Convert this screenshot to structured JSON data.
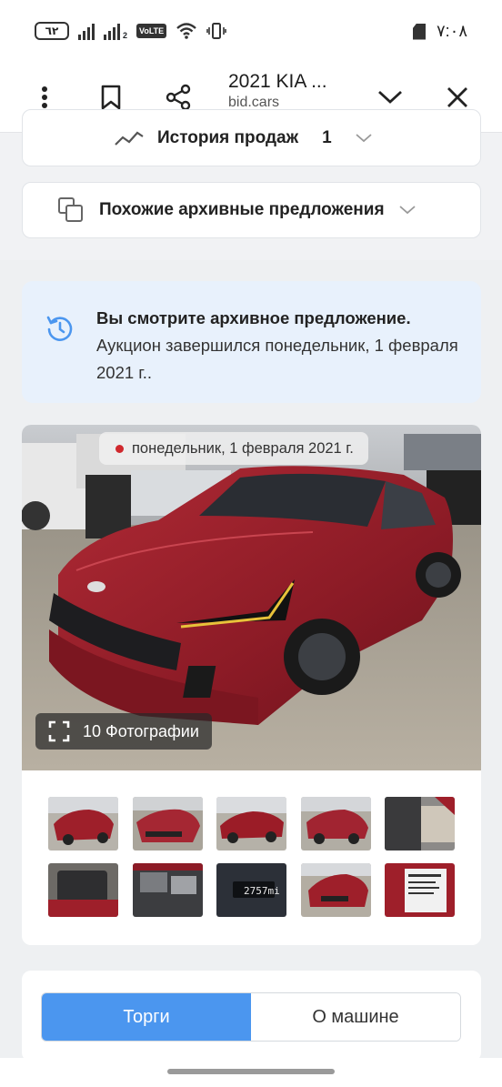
{
  "status_bar": {
    "battery": "٦٢",
    "sim2": "2",
    "volte": "VoLTE",
    "time": "٧:٠٨"
  },
  "header": {
    "title": "2021 KIA ...",
    "url": "bid.cars",
    "icons": [
      "more-vert-icon",
      "bookmark-icon",
      "share-icon",
      "chevron-down-icon",
      "close-icon"
    ]
  },
  "sales_history": {
    "label": "История продаж",
    "count": "1"
  },
  "similar": {
    "label": "Похожие архивные предложения"
  },
  "notice": {
    "bold": "Вы смотрите архивное предложение.",
    "text": " Аукцион завершился понедельник, 1 февраля 2021 г.."
  },
  "gallery": {
    "date": "понедельник, 1 февраля 2021 г.",
    "photos_label": "10 Фотографии",
    "thumb_text": "2757mi"
  },
  "tabs": {
    "bidding": "Торги",
    "about": "О машине"
  },
  "colors": {
    "accent": "#4b96ef",
    "notice_bg": "#e8f1fc",
    "car_red": "#9e1f2a"
  }
}
